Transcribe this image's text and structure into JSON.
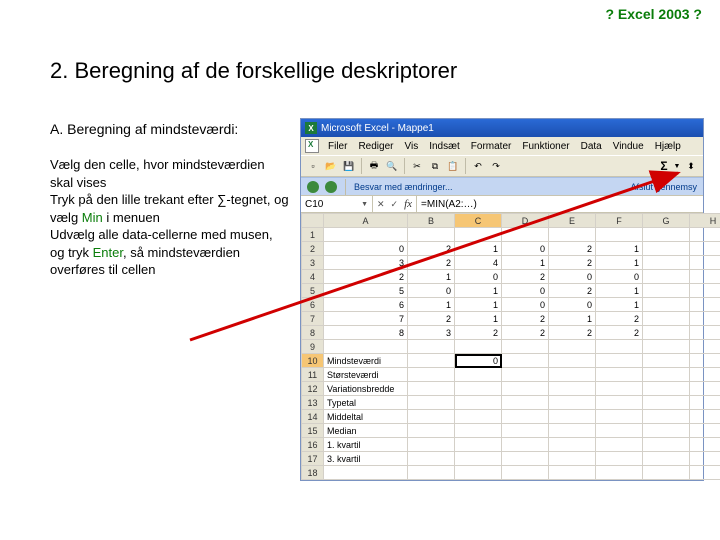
{
  "header_link": "? Excel 2003 ?",
  "title": "2. Beregning af de forskellige deskriptorer",
  "subhead": "A. Beregning af mindsteværdi:",
  "body": {
    "p1a": "Vælg den celle, hvor mindsteværdien skal vises",
    "p2a": "Tryk på den lille trekant efter ∑-tegnet, og vælg ",
    "p2b": "Min",
    "p2c": " i menuen",
    "p3a": "Udvælg alle data-cellerne med musen, og tryk ",
    "p3b": "Enter",
    "p3c": ", så mindsteværdien overføres til cellen"
  },
  "excel": {
    "title": "Microsoft Excel - Mappe1",
    "menus": [
      "Filer",
      "Rediger",
      "Vis",
      "Indsæt",
      "Formater",
      "Funktioner",
      "Data",
      "Vindue",
      "Hjælp"
    ],
    "sigma": "Σ",
    "task_left": "Besvar med ændringer...",
    "task_right": "Afslut gennemsy",
    "name_box": "C10",
    "fx": "fx",
    "formula": "=MIN(A2:…)",
    "col_headers": [
      "",
      "A",
      "B",
      "C",
      "D",
      "E",
      "F",
      "G",
      "H"
    ],
    "rows": [
      {
        "r": "1",
        "cells": [
          "",
          "",
          "",
          "",
          "",
          "",
          "",
          ""
        ]
      },
      {
        "r": "2",
        "cells": [
          "0",
          "2",
          "1",
          "0",
          "2",
          "1",
          "",
          ""
        ]
      },
      {
        "r": "3",
        "cells": [
          "3",
          "2",
          "4",
          "1",
          "2",
          "1",
          "",
          ""
        ]
      },
      {
        "r": "4",
        "cells": [
          "2",
          "1",
          "0",
          "2",
          "0",
          "0",
          "",
          ""
        ]
      },
      {
        "r": "5",
        "cells": [
          "5",
          "0",
          "1",
          "0",
          "2",
          "1",
          "",
          ""
        ]
      },
      {
        "r": "6",
        "cells": [
          "6",
          "1",
          "1",
          "0",
          "0",
          "1",
          "",
          ""
        ]
      },
      {
        "r": "7",
        "cells": [
          "7",
          "2",
          "1",
          "2",
          "1",
          "2",
          "",
          ""
        ]
      },
      {
        "r": "8",
        "cells": [
          "8",
          "3",
          "2",
          "2",
          "2",
          "2",
          "",
          ""
        ]
      },
      {
        "r": "9",
        "cells": [
          "",
          "",
          "",
          "",
          "",
          "",
          "",
          ""
        ]
      },
      {
        "r": "10",
        "cells": [
          "Mindsteværdi",
          "",
          "0",
          "",
          "",
          "",
          "",
          ""
        ]
      },
      {
        "r": "11",
        "cells": [
          "Størsteværdi",
          "",
          "",
          "",
          "",
          "",
          "",
          ""
        ]
      },
      {
        "r": "12",
        "cells": [
          "Variationsbredde",
          "",
          "",
          "",
          "",
          "",
          "",
          ""
        ]
      },
      {
        "r": "13",
        "cells": [
          "Typetal",
          "",
          "",
          "",
          "",
          "",
          "",
          ""
        ]
      },
      {
        "r": "14",
        "cells": [
          "Middeltal",
          "",
          "",
          "",
          "",
          "",
          "",
          ""
        ]
      },
      {
        "r": "15",
        "cells": [
          "Median",
          "",
          "",
          "",
          "",
          "",
          "",
          ""
        ]
      },
      {
        "r": "16",
        "cells": [
          "1. kvartil",
          "",
          "",
          "",
          "",
          "",
          "",
          ""
        ]
      },
      {
        "r": "17",
        "cells": [
          "3. kvartil",
          "",
          "",
          "",
          "",
          "",
          "",
          ""
        ]
      },
      {
        "r": "18",
        "cells": [
          "",
          "",
          "",
          "",
          "",
          "",
          "",
          ""
        ]
      }
    ]
  }
}
